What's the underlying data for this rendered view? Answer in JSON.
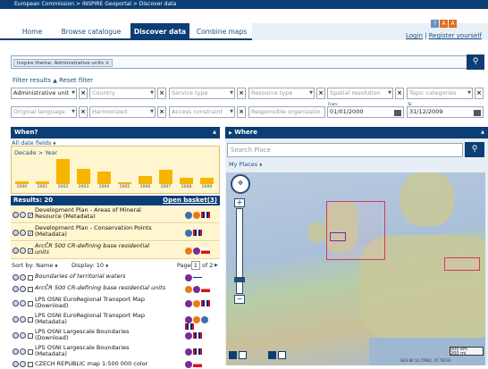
{
  "breadcrumb": "European Commission > INSPIRE Geoportal > Discover data",
  "nav": {
    "tabs": [
      {
        "label": "Home"
      },
      {
        "label": "Browse catalogue"
      },
      {
        "label": "Discover data"
      },
      {
        "label": "Combine maps"
      }
    ],
    "login": "Login",
    "separator": "|",
    "register": "Register yourself"
  },
  "search": {
    "chip": "Inspire theme: Administrative units ×"
  },
  "filters": {
    "filter_results": "Filter results",
    "reset_filter": "Reset filter",
    "row1": [
      {
        "text": "Administrative unit",
        "filled": true
      },
      {
        "text": "Country",
        "filled": false
      },
      {
        "text": "Service type",
        "filled": false
      },
      {
        "text": "Resource type",
        "filled": false
      },
      {
        "text": "Spatial resolution",
        "filled": false
      },
      {
        "text": "Topic categories",
        "filled": false
      }
    ],
    "row2": [
      {
        "text": "Original language",
        "filled": false
      },
      {
        "text": "Harmonized",
        "filled": false
      },
      {
        "text": "Access constraint",
        "filled": false
      },
      {
        "text": "Responsible organizatio",
        "filled": false
      },
      {
        "text": "01/01/2000",
        "filled": true
      },
      {
        "text": "31/12/2009",
        "filled": true
      }
    ],
    "from_label": "From:",
    "to_label": "To:"
  },
  "when": {
    "title": "When?",
    "date_fields": "All date fields",
    "decade": "Decade > Year"
  },
  "chart_data": {
    "type": "bar",
    "categories": [
      "2000",
      "2001",
      "2002",
      "2003",
      "2004",
      "2005",
      "2006",
      "2007",
      "2008",
      "2009"
    ],
    "values": [
      2,
      2,
      16,
      10,
      8,
      1,
      5,
      9,
      4,
      4
    ]
  },
  "results": {
    "title": "Results: 20",
    "basket": "Open basket(3)",
    "sort": "Sort by: Name",
    "display": "Display: 10",
    "page": "Page",
    "page_num": "1",
    "page_of": "of 2",
    "selected": [
      {
        "title": "Development Plan - Areas of Mineral",
        "title2": "Resource (Metadata)",
        "italic": false
      },
      {
        "title": "Development Plan - Conservation Points",
        "title2": "(Metadata)",
        "italic": false
      },
      {
        "title": "ArcČR 500 CR-defining base residential",
        "title2": "units",
        "italic": true
      }
    ],
    "items": [
      {
        "title": "Boundaries of territorial waters",
        "title2": "",
        "italic": true
      },
      {
        "title": "ArcČR 500 CR-defining base residential units",
        "title2": "",
        "italic": true
      },
      {
        "title": "LPS OSNI EuroRegional Transport Map",
        "title2": "(Download)",
        "italic": false
      },
      {
        "title": "LPS OSNI EuroRegional Transport Map",
        "title2": "(Metadata)",
        "italic": false
      },
      {
        "title": "LPS OSNI Largescale Boundaries",
        "title2": "(Download)",
        "italic": false
      },
      {
        "title": "LPS OSNI Largescale Boundaries",
        "title2": "(Metadata)",
        "italic": false
      },
      {
        "title": "CZECH REPUBLIC map 1:500 000 color",
        "title2": "",
        "italic": false
      }
    ]
  },
  "where": {
    "title": "Where",
    "search_placeholder": "Search Place",
    "my_places": "My Places",
    "scale_km": "500 km",
    "scale_mi": "200 mi",
    "coords": "GES:84 14.77862, 47.78733"
  },
  "colors": {
    "navy": "#0b3e74",
    "accent": "#f7b500",
    "highlight": "#fff6cf"
  }
}
